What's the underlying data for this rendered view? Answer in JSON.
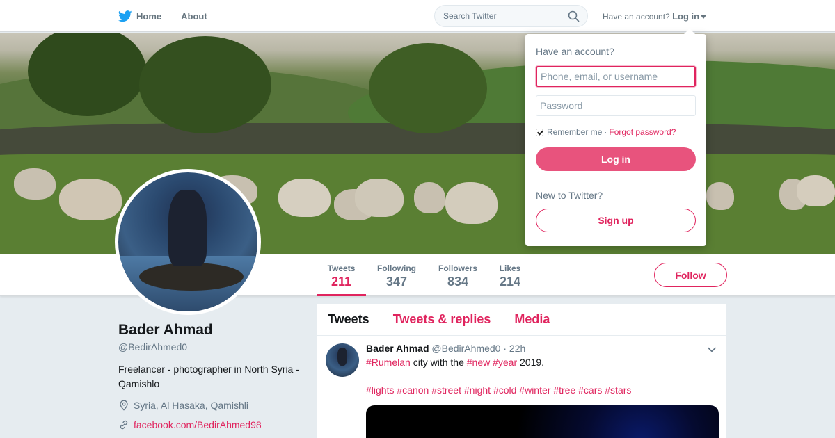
{
  "nav": {
    "logo_icon": "twitter-bird-icon",
    "home_label": "Home",
    "about_label": "About",
    "search_placeholder": "Search Twitter",
    "have_account_text": "Have an account?",
    "login_label": "Log in"
  },
  "profile": {
    "name": "Bader Ahmad",
    "handle": "@BedirAhmed0",
    "bio": "Freelancer - photographer in North Syria - Qamishlo",
    "location": "Syria, Al Hasaka, Qamishli",
    "link": "facebook.com/BedirAhmed98"
  },
  "stats": [
    {
      "label": "Tweets",
      "value": "211",
      "active": true
    },
    {
      "label": "Following",
      "value": "347"
    },
    {
      "label": "Followers",
      "value": "834"
    },
    {
      "label": "Likes",
      "value": "214"
    }
  ],
  "follow_label": "Follow",
  "timeline": {
    "tabs": [
      "Tweets",
      "Tweets & replies",
      "Media"
    ],
    "tweet": {
      "name": "Bader Ahmad",
      "handle": "@BedirAhmed0",
      "separator": "·",
      "time": "22h",
      "line1": {
        "tag1": "#Rumelan",
        "text1": " city with the ",
        "tag2": "#new",
        "tag3": "#year",
        "text2": " 2019."
      },
      "hashtags": [
        "#lights",
        "#canon",
        "#street",
        "#night",
        "#cold",
        "#winter",
        "#tree",
        "#cars",
        "#stars"
      ]
    }
  },
  "login_dropdown": {
    "title": "Have an account?",
    "username_placeholder": "Phone, email, or username",
    "password_placeholder": "Password",
    "remember_label": "Remember me",
    "separator": "·",
    "forgot_label": "Forgot password?",
    "login_button": "Log in",
    "new_text": "New to Twitter?",
    "signup_button": "Sign up"
  },
  "colors": {
    "accent": "#e0245e",
    "brand": "#1da1f2"
  }
}
